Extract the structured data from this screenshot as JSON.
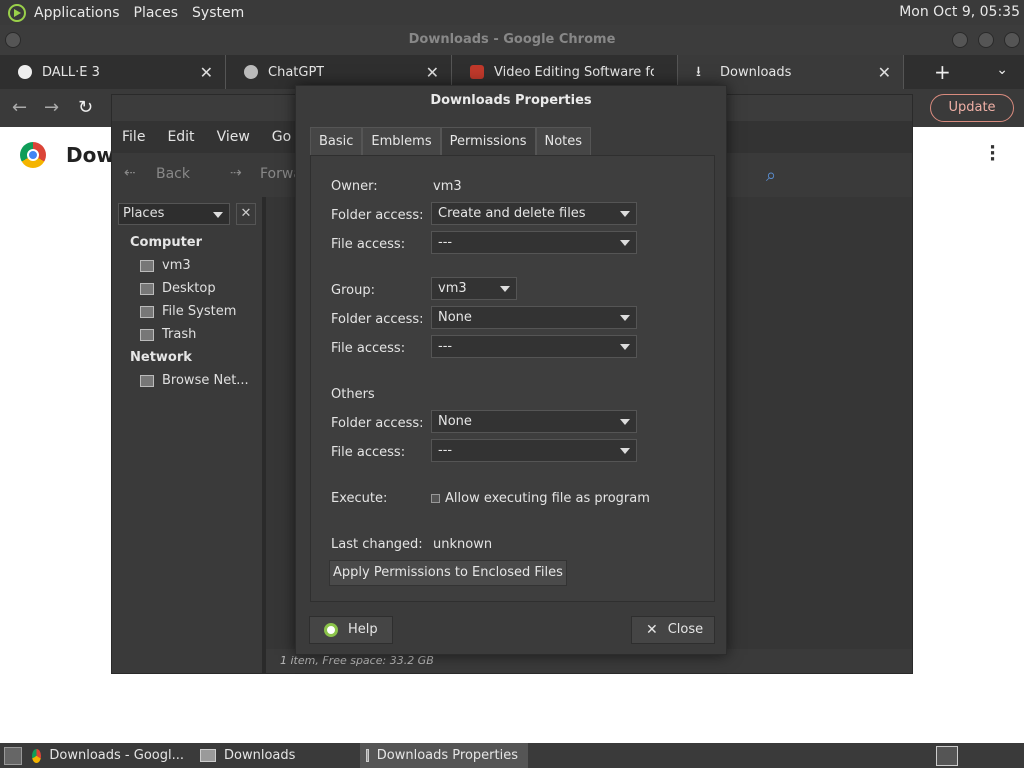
{
  "top_panel": {
    "menu": [
      "Applications",
      "Places",
      "System"
    ],
    "clock": "Mon Oct  9, 05:35"
  },
  "chrome": {
    "window_title": "Downloads - Google Chrome",
    "tabs": [
      {
        "label": "DALL·E 3",
        "icon": "openai-icon"
      },
      {
        "label": "ChatGPT",
        "icon": "chatgpt-icon"
      },
      {
        "label": "Video Editing Software for F",
        "icon": "app-icon"
      },
      {
        "label": "Downloads",
        "icon": "download-icon"
      }
    ],
    "update_label": "Update",
    "page_heading": "Dow"
  },
  "file_manager": {
    "menu": [
      "File",
      "Edit",
      "View",
      "Go"
    ],
    "toolbar": {
      "back": "Back",
      "forward": "Forwa"
    },
    "places_label": "Places",
    "sidebar": {
      "computer_header": "Computer",
      "computer_items": [
        "vm3",
        "Desktop",
        "File System",
        "Trash"
      ],
      "network_header": "Network",
      "network_items": [
        "Browse Net..."
      ]
    },
    "status": "1 item, Free space: 33.2 GB"
  },
  "dialog": {
    "title": "Downloads Properties",
    "tabs": [
      "Basic",
      "Emblems",
      "Permissions",
      "Notes"
    ],
    "owner_label": "Owner:",
    "owner_value": "vm3",
    "owner_folder_label": "Folder access:",
    "owner_folder_value": "Create and delete files",
    "owner_file_label": "File access:",
    "owner_file_value": "---",
    "group_label": "Group:",
    "group_value": "vm3",
    "group_folder_label": "Folder access:",
    "group_folder_value": "None",
    "group_file_label": "File access:",
    "group_file_value": "---",
    "others_label": "Others",
    "others_folder_label": "Folder access:",
    "others_folder_value": "None",
    "others_file_label": "File access:",
    "others_file_value": "---",
    "execute_label": "Execute:",
    "execute_checkbox_label": "Allow executing file as program",
    "last_changed_label": "Last changed:",
    "last_changed_value": "unknown",
    "apply_label": "Apply Permissions to Enclosed Files",
    "help_label": "Help",
    "close_label": "Close"
  },
  "taskbar": {
    "tasks": [
      "Downloads - Googl...",
      "Downloads",
      "Downloads Properties"
    ]
  }
}
